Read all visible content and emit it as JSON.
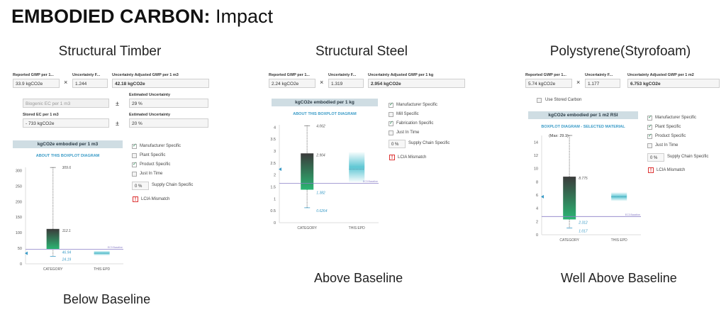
{
  "heading": {
    "bold": "EMBODIED CARBON:",
    "light": "Impact"
  },
  "panels": [
    {
      "title": "Structural Timber",
      "caption": "Below Baseline",
      "reported_label": "Reported GWP per 1...",
      "reported_value": "33.9 kgCO2e",
      "uncert_label": "Uncertainty F...",
      "uncert_value": "1.244",
      "adjusted_label": "Uncertainty Adjusted GWP per 1 m3",
      "adjusted_value": "42.18 kgCO2e",
      "op_times": "×",
      "biogenic_placeholder": "Biogenic EC per 1 m3",
      "stored_label": "Stored EC per 1 m3",
      "stored_value": "- 733 kgCO2e",
      "est_label_1": "Estimated Uncertainty",
      "est_value_1": "29 %",
      "est_label_2": "Estimated Uncertainty",
      "est_value_2": "20 %",
      "pm": "±",
      "chart_header": "kgCO2e embodied per 1 m3",
      "chart_link": "ABOUT THIS BOXPLOT DIAGRAM",
      "checks": [
        {
          "label": "Manufacturer Specific",
          "checked": true
        },
        {
          "label": "Plant Specific",
          "checked": false
        },
        {
          "label": "Product Specific",
          "checked": true
        },
        {
          "label": "Just In Time",
          "checked": false
        }
      ],
      "supply_pct": "0 %",
      "supply_label": "Supply Chain Specific",
      "lcia_label": "LCIA Mismatch",
      "warn_glyph": "!"
    },
    {
      "title": "Structural Steel",
      "caption": "Above Baseline",
      "reported_label": "Reported GWP per 1...",
      "reported_value": "2.24 kgCO2e",
      "uncert_label": "Uncertainty F...",
      "uncert_value": "1.319",
      "adjusted_label": "Uncertainty Adjusted GWP per 1 kg",
      "adjusted_value": "2.954 kgCO2e",
      "op_times": "×",
      "chart_header": "kgCO2e embodied per 1 kg",
      "chart_link": "ABOUT THIS BOXPLOT DIAGRAM",
      "checks": [
        {
          "label": "Manufacturer Specific",
          "checked": true
        },
        {
          "label": "Mill Specific",
          "checked": false
        },
        {
          "label": "Fabrication Specific",
          "checked": true
        },
        {
          "label": "Just In Time",
          "checked": false
        }
      ],
      "supply_pct": "0 %",
      "supply_label": "Supply Chain Specific",
      "lcia_label": "LCIA Mismatch",
      "warn_glyph": "!"
    },
    {
      "title": "Polystyrene(Styrofoam)",
      "caption": "Well Above Baseline",
      "reported_label": "Reported GWP per 1...",
      "reported_value": "5.74 kgCO2e",
      "uncert_label": "Uncertainty F...",
      "uncert_value": "1.177",
      "adjusted_label": "Uncertainty Adjusted GWP per 1 m2",
      "adjusted_value": "6.753 kgCO2e",
      "op_times": "×",
      "stored_carbon_label": "Use Stored Carbon",
      "chart_header": "kgCO2e embodied per 1 m2 RSI",
      "chart_link": "BOXPLOT DIAGRAM - SELECTED MATERIAL",
      "checks": [
        {
          "label": "Manufacturer Specific",
          "checked": true
        },
        {
          "label": "Plant Specific",
          "checked": true
        },
        {
          "label": "Product Specific",
          "checked": true
        },
        {
          "label": "Just In Time",
          "checked": false
        }
      ],
      "supply_pct": "0 %",
      "supply_label": "Supply Chain Specific",
      "lcia_label": "LCIA Mismatch",
      "warn_glyph": "!"
    }
  ],
  "chart_data": [
    {
      "type": "box",
      "categories": [
        "CATEGORY",
        "THIS EPD"
      ],
      "yticks": [
        0,
        50,
        100,
        150,
        200,
        250,
        300
      ],
      "ylim": [
        0,
        310
      ],
      "category_box": {
        "min": 24.19,
        "q1": 46.94,
        "q3": 112.1,
        "max": 309.6
      },
      "epd_value": 33.9,
      "epd_band": [
        27,
        42
      ],
      "baseline": 46.94,
      "baseline_label": "EC3 Baseline",
      "labels": {
        "max": "309.6",
        "q3": "112.1",
        "q1": "46.94",
        "min": "24.19"
      },
      "colors": {
        "box_top": "#3b3b3b",
        "box_bottom": "#2bb673",
        "epd": "#4cc0cf",
        "baseline": "#8a7fc7",
        "marker": "#3a9bc7"
      }
    },
    {
      "type": "box",
      "categories": [
        "CATEGORY",
        "THIS EPD"
      ],
      "yticks": [
        0.0,
        0.5,
        1.0,
        1.5,
        2.0,
        2.5,
        3.0,
        3.5,
        4.0
      ],
      "ylim": [
        0,
        4.1
      ],
      "category_box": {
        "min": 0.6264,
        "q1": 1.382,
        "q3": 2.904,
        "max": 4.062
      },
      "epd_value": 2.24,
      "epd_band": [
        1.7,
        2.95
      ],
      "baseline": 1.65,
      "baseline_label": "EC3 Baseline",
      "labels": {
        "max": "4.062",
        "q3": "2.904",
        "q1": "1.382",
        "min": "0.6264"
      },
      "colors": {
        "box_top": "#3b3b3b",
        "box_bottom": "#2bb673",
        "epd": "#4cc0cf",
        "baseline": "#8a7fc7",
        "marker": "#3a9bc7"
      }
    },
    {
      "type": "box",
      "categories": [
        "CATEGORY",
        "THIS EPD"
      ],
      "yticks": [
        0,
        2,
        4,
        6,
        8,
        10,
        12,
        14
      ],
      "ylim": [
        0,
        15
      ],
      "max_note": "(Max: 29.1)",
      "category_box": {
        "min": 1.017,
        "q1": 2.312,
        "q3": 8.775,
        "max": 15
      },
      "epd_value": 5.74,
      "epd_band": [
        5.1,
        6.4
      ],
      "baseline": 2.75,
      "baseline_label": "EC3 Baseline",
      "labels": {
        "max": "",
        "q3": "8.775",
        "q1": "2.312",
        "min": "1.017"
      },
      "colors": {
        "box_top": "#3b3b3b",
        "box_bottom": "#2bb673",
        "epd": "#4cc0cf",
        "baseline": "#8a7fc7",
        "marker": "#3a9bc7"
      }
    }
  ]
}
